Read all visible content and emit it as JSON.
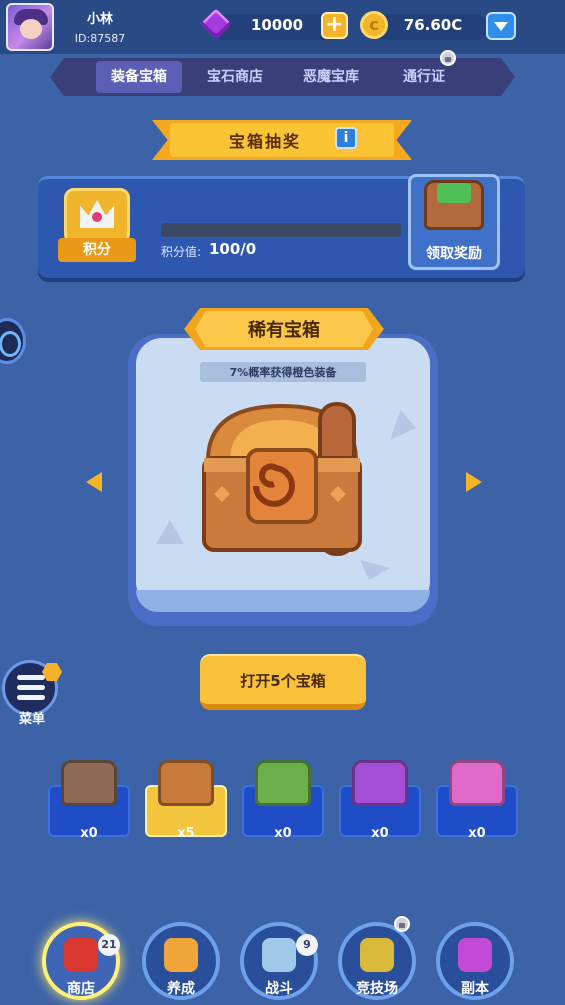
{
  "player": {
    "name": "小林",
    "id": "ID:87587"
  },
  "resources": {
    "gems": "10000",
    "coins": "76.60C"
  },
  "tabs": [
    {
      "label": "装备宝箱",
      "active": true
    },
    {
      "label": "宝石商店",
      "active": false
    },
    {
      "label": "恶魔宝库",
      "active": false
    },
    {
      "label": "通行证",
      "active": false,
      "locked": true
    }
  ],
  "section": {
    "title": "宝箱抽奖",
    "info": "i"
  },
  "points": {
    "badge_label": "积分",
    "caption": "积分值:",
    "value": "100/0",
    "progress": 0,
    "claim_label": "领取奖励"
  },
  "chest": {
    "title": "稀有宝箱",
    "chance_text": "7%概率获得橙色装备"
  },
  "open_button": {
    "label": "打开5个宝箱"
  },
  "menu": {
    "label": "菜单"
  },
  "inventory": [
    {
      "name": "silver-chest",
      "count": "x0",
      "color": "#8d6a55",
      "selected": false
    },
    {
      "name": "bronze-chest",
      "count": "x5",
      "color": "#c87a3a",
      "selected": true
    },
    {
      "name": "green-chest",
      "count": "x0",
      "color": "#6bb04a",
      "selected": false
    },
    {
      "name": "purple-chest",
      "count": "x0",
      "color": "#a54fd6",
      "selected": false
    },
    {
      "name": "pink-chest",
      "count": "x0",
      "color": "#e06ac9",
      "selected": false
    }
  ],
  "nav": [
    {
      "label": "商店",
      "active": true,
      "badge": "21"
    },
    {
      "label": "养成",
      "active": false,
      "badge": ""
    },
    {
      "label": "战斗",
      "active": false,
      "badge": "9"
    },
    {
      "label": "竞技场",
      "active": false,
      "badge": "",
      "locked": true
    },
    {
      "label": "副本",
      "active": false,
      "badge": ""
    }
  ],
  "colors": {
    "background": "#3c63a8",
    "accent": "#f6b324",
    "panel": "#2e58b0"
  }
}
